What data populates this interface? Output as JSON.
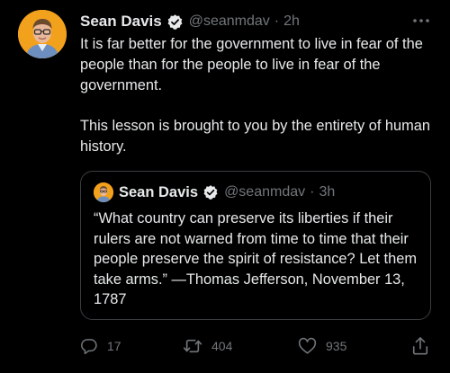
{
  "tweet": {
    "author_name": "Sean Davis",
    "author_handle": "@seanmdav",
    "separator": "·",
    "time": "2h",
    "text_lines": [
      "It is far better for the government to live in fear of the people than for the people to live in fear of the government.",
      "This lesson is brought to you by the entirety of human history."
    ]
  },
  "quoted_tweet": {
    "author_name": "Sean Davis",
    "author_handle": "@seanmdav",
    "separator": "·",
    "time": "3h",
    "text": "“What country can preserve its liberties if their rulers are not warned from time to time that their people preserve the spirit of resistance? Let them take arms.” —Thomas Jefferson, November 13, 1787"
  },
  "actions": {
    "reply_count": "17",
    "retweet_count": "404",
    "like_count": "935"
  },
  "icons": {
    "verified": "verified-badge-icon",
    "more": "more-options-icon",
    "reply": "reply-icon",
    "retweet": "retweet-icon",
    "like": "heart-icon",
    "share": "share-icon"
  },
  "colors": {
    "background": "#000000",
    "text": "#e7e9ea",
    "secondary_text": "#71767b",
    "border": "#3a3d41",
    "avatar_background": "#f2a11c"
  }
}
